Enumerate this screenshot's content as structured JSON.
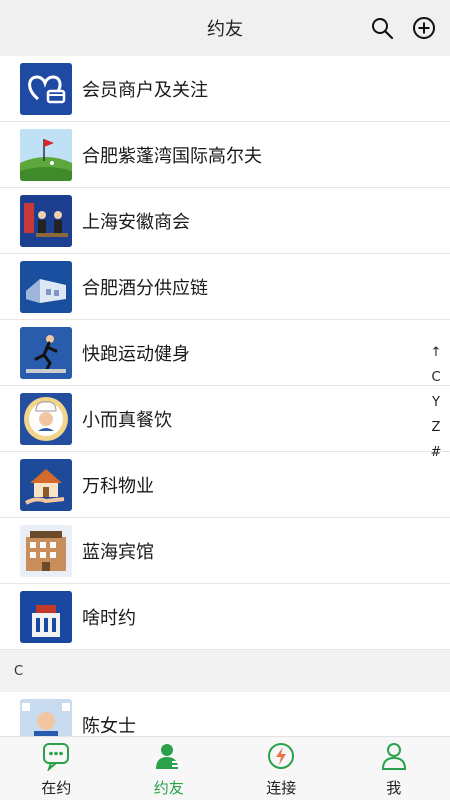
{
  "header": {
    "title": "约友",
    "search_icon": "search-icon",
    "add_icon": "plus-circle-icon"
  },
  "contacts": [
    {
      "label": "会员商户及关注",
      "avatar": "heart-card-icon",
      "bg": "#1f4aa3"
    },
    {
      "label": "合肥紫蓬湾国际高尔夫",
      "avatar": "golf-icon",
      "bg": "#2e5fb0"
    },
    {
      "label": "上海安徽商会",
      "avatar": "meeting-icon",
      "bg": "#1c3f8f"
    },
    {
      "label": "合肥酒分供应链",
      "avatar": "warehouse-icon",
      "bg": "#1a4fa0"
    },
    {
      "label": "快跑运动健身",
      "avatar": "runner-icon",
      "bg": "#2a5cae"
    },
    {
      "label": "小而真餐饮",
      "avatar": "chef-icon",
      "bg": "#234f9e"
    },
    {
      "label": "万科物业",
      "avatar": "house-hand-icon",
      "bg": "#1e4a9a"
    },
    {
      "label": "蓝海宾馆",
      "avatar": "hotel-icon",
      "bg": "#e9eef7"
    },
    {
      "label": "啥时约",
      "avatar": "building-icon",
      "bg": "#1a47a0"
    }
  ],
  "section": {
    "label": "C"
  },
  "section_contacts": [
    {
      "label": "陈女士",
      "avatar": "baby-photo-icon",
      "bg": "#c9dcef"
    }
  ],
  "index_bar": [
    "↑",
    "C",
    "Y",
    "Z",
    "#"
  ],
  "tabs": [
    {
      "label": "在约",
      "icon": "chat-bubble-icon"
    },
    {
      "label": "约友",
      "icon": "contacts-icon",
      "active": true
    },
    {
      "label": "连接",
      "icon": "lightning-icon"
    },
    {
      "label": "我",
      "icon": "user-icon"
    }
  ],
  "colors": {
    "accent": "#2aa14a",
    "header_bg": "#f0f0f0",
    "section_bg": "#f2f2f2"
  }
}
